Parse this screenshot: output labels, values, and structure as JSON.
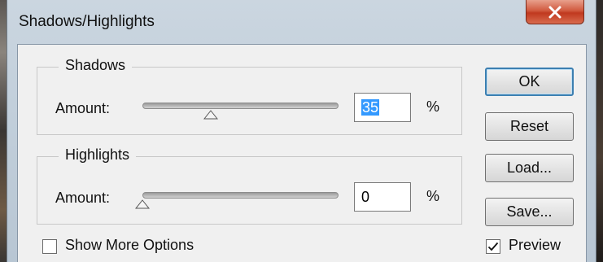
{
  "window": {
    "title": "Shadows/Highlights",
    "close_icon": "close-x-icon",
    "close_color": "#c0391f"
  },
  "shadows": {
    "title": "Shadows",
    "amount_label": "Amount:",
    "amount_value": "35",
    "amount_selected": true,
    "unit": "%"
  },
  "highlights": {
    "title": "Highlights",
    "amount_label": "Amount:",
    "amount_value": "0",
    "unit": "%"
  },
  "buttons": {
    "ok": "OK",
    "reset": "Reset",
    "load": "Load...",
    "save": "Save..."
  },
  "options": {
    "show_more_label": "Show More Options",
    "show_more_checked": false,
    "preview_label": "Preview",
    "preview_checked": true
  },
  "colors": {
    "selection": "#3399ff",
    "default_button_border": "#3c7fb1"
  }
}
